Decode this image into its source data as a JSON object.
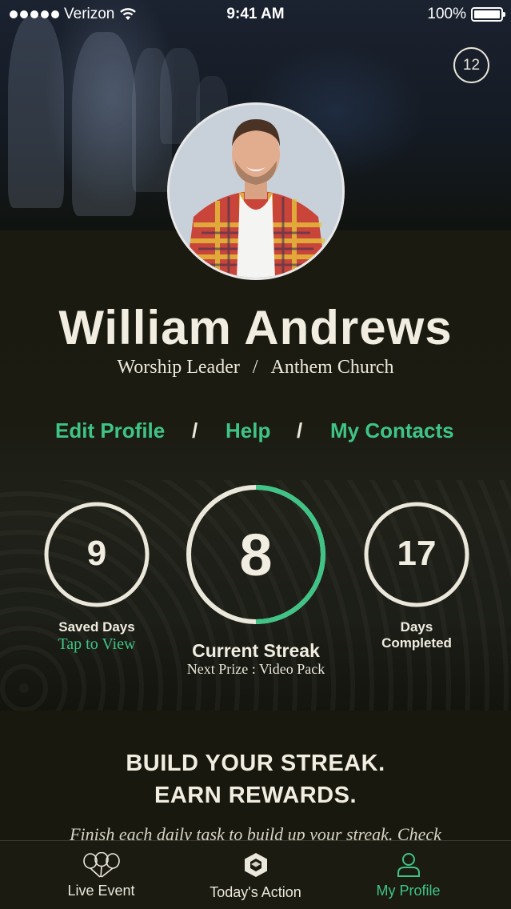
{
  "status_bar": {
    "carrier": "Verizon",
    "time": "9:41 AM",
    "battery": "100%"
  },
  "notifications": {
    "count": "12"
  },
  "profile": {
    "name": "William Andrews",
    "role": "Worship Leader",
    "separator": "/",
    "church": "Anthem Church"
  },
  "links": {
    "edit_profile": "Edit Profile",
    "help": "Help",
    "my_contacts": "My Contacts",
    "separator": "/"
  },
  "stats": {
    "saved_days": {
      "value": "9",
      "label": "Saved Days",
      "action": "Tap to View"
    },
    "current_streak": {
      "value": "8",
      "label": "Current Streak",
      "next_prize": "Next Prize : Video Pack",
      "progress": 0.5
    },
    "days_completed": {
      "value": "17",
      "label_line1": "Days",
      "label_line2": "Completed"
    }
  },
  "promo": {
    "headline_line1": "BUILD YOUR STREAK.",
    "headline_line2": "EARN REWARDS.",
    "body": "Finish each daily task to build up your streak. Check"
  },
  "tab_bar": {
    "tabs": [
      {
        "label": "Live Event",
        "icon": "balloons-icon",
        "active": false
      },
      {
        "label": "Today's Action",
        "icon": "hexagon-icon",
        "active": false
      },
      {
        "label": "My Profile",
        "icon": "person-icon",
        "active": true
      }
    ]
  },
  "colors": {
    "accent": "#3fc486",
    "text": "#f1ede0",
    "background": "#1b1b12"
  }
}
